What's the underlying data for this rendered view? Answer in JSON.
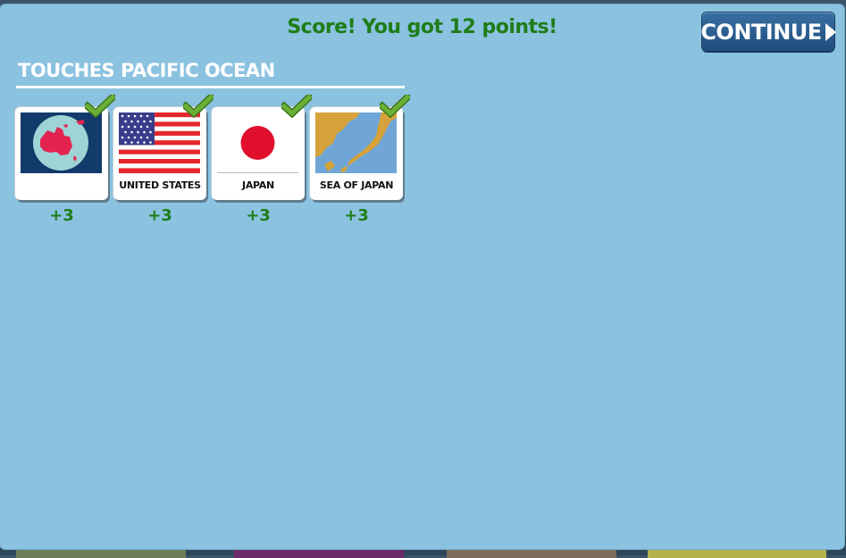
{
  "score_message": "Score! You got 12 points!",
  "continue_label": "CONTINUE",
  "category_title": "TOUCHES PACIFIC OCEAN",
  "cards": [
    {
      "label": "",
      "points": "+3",
      "icon": "australia-globe-icon",
      "correct": true
    },
    {
      "label": "UNITED STATES",
      "points": "+3",
      "icon": "us-flag-icon",
      "correct": true
    },
    {
      "label": "JAPAN",
      "points": "+3",
      "icon": "japan-flag-icon",
      "correct": true
    },
    {
      "label": "SEA OF JAPAN",
      "points": "+3",
      "icon": "sea-of-japan-map-icon",
      "correct": true
    }
  ],
  "colors": {
    "panel": "#8bc2e0",
    "score_green": "#1e7d17",
    "button_blue": "#2a5b8d",
    "check_green": "#5a9a2c"
  }
}
